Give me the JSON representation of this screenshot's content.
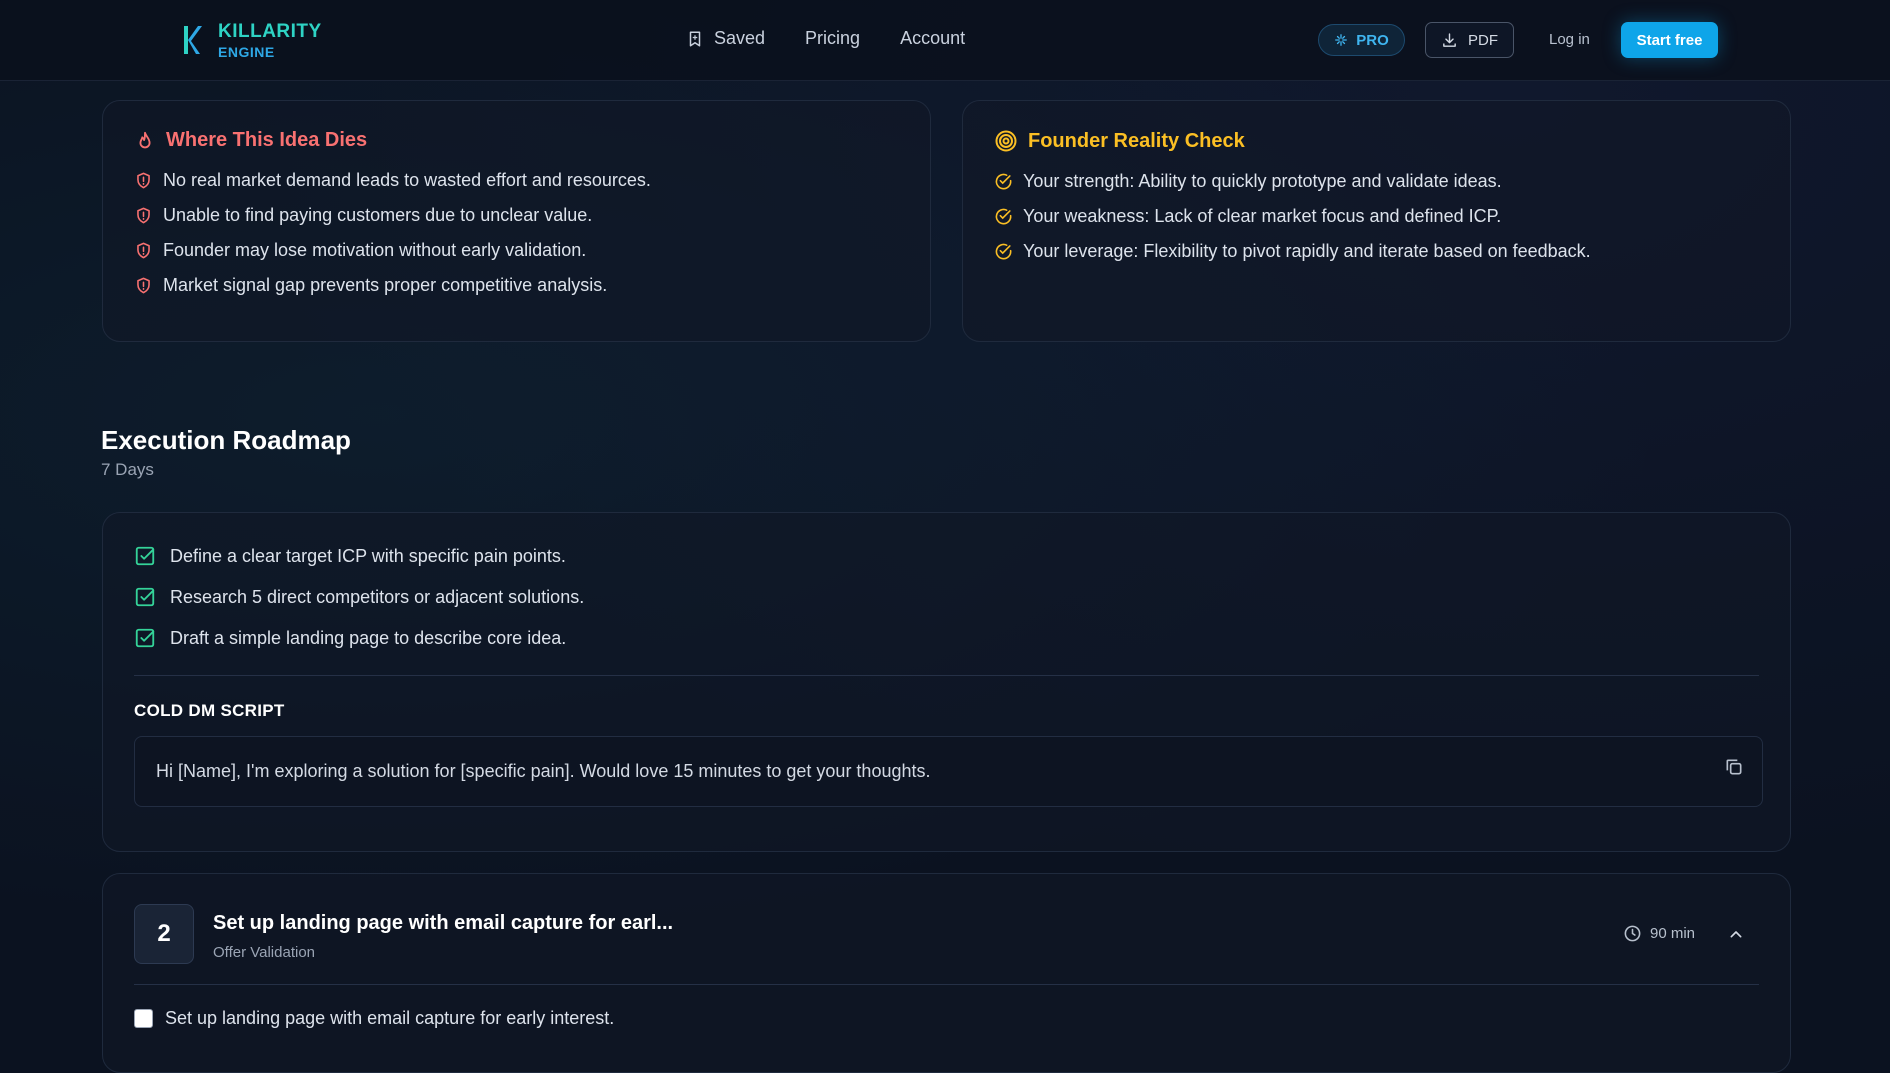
{
  "header": {
    "logo_line1": "KILLARITY",
    "logo_line2": "ENGINE",
    "nav": [
      {
        "label": "Saved",
        "icon": "bookmark-icon"
      },
      {
        "label": "Pricing"
      },
      {
        "label": "Account"
      }
    ],
    "pro_label": "PRO",
    "pdf_label": "PDF",
    "login_label": "Log in",
    "start_label": "Start free"
  },
  "dies": {
    "title": "Where This Idea Dies",
    "icon": "flame-icon",
    "items": [
      "No real market demand leads to wasted effort and resources.",
      "Unable to find paying customers due to unclear value.",
      "Founder may lose motivation without early validation.",
      "Market signal gap prevents proper competitive analysis."
    ]
  },
  "reality": {
    "title": "Founder Reality Check",
    "icon": "target-icon",
    "items": [
      "Your strength: Ability to quickly prototype and validate ideas.",
      "Your weakness: Lack of clear market focus and defined ICP.",
      "Your leverage: Flexibility to pivot rapidly and iterate based on feedback."
    ]
  },
  "roadmap": {
    "title": "Execution Roadmap",
    "subtitle": "7 Days",
    "tasks": [
      "Define a clear target ICP with specific pain points.",
      "Research 5 direct competitors or adjacent solutions.",
      "Draft a simple landing page to describe core idea."
    ],
    "script_label": "COLD DM SCRIPT",
    "script_text": "Hi [Name], I'm exploring a solution for [specific pain]. Would love 15 minutes to get your thoughts."
  },
  "step2": {
    "number": "2",
    "title": "Set up landing page with email capture for earl...",
    "subtitle": "Offer Validation",
    "time": "90 min",
    "subtask": "Set up landing page with email capture for early interest."
  },
  "colors": {
    "accent": "#0ea5e9",
    "danger": "#f87171",
    "warning": "#fbbf24",
    "success": "#34d399"
  }
}
